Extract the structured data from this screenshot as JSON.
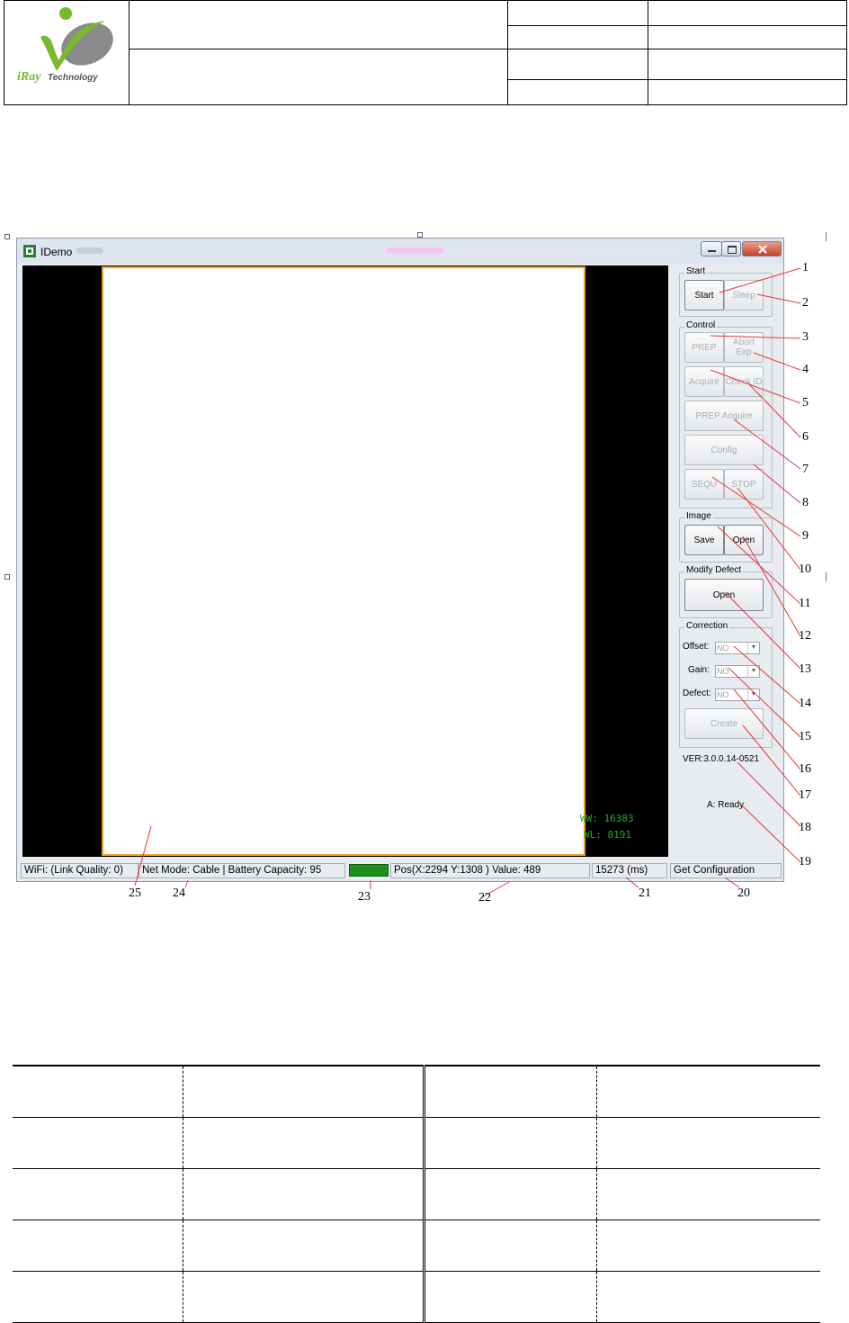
{
  "header": {
    "logo_text": "iRayTechnology",
    "logo_colors": {
      "green": "#7ab82e",
      "gray": "#8a8a8a"
    }
  },
  "window": {
    "title": "IDemo",
    "app_icon": "app-icon",
    "controls": [
      "minimize-icon",
      "maximize-icon",
      "close-icon"
    ],
    "viewer": {
      "ww": "WW: 16383",
      "wl": "WL:  8191"
    },
    "panel": {
      "start_group": {
        "title": "Start",
        "start": "Start",
        "sleep": "Sleep"
      },
      "control_group": {
        "title": "Control",
        "prep": "PREP",
        "abort": "Abort Exp",
        "acquire": "Acquire",
        "check_id": "Check ID",
        "prep_acquire": "PREP Acquire",
        "config": "Config",
        "sequ": "SEQU",
        "stop": "STOP"
      },
      "image_group": {
        "title": "Image",
        "save": "Save",
        "open": "Open"
      },
      "defect_group": {
        "title": "Modify Defect",
        "open": "Open"
      },
      "correction_group": {
        "title": "Correction",
        "offset_label": "Offset:",
        "offset_value": "NO",
        "gain_label": "Gain:",
        "gain_value": "NO",
        "defect_label": "Defect:",
        "defect_value": "NO",
        "create": "Create"
      },
      "version": "VER:3.0.0.14-0521",
      "state": "A: Ready"
    },
    "status_bar": {
      "link": "WiFi:  (Link Quality: 0)",
      "info": "Net Mode: Cable | Battery Capacity: 95",
      "indicator_color": "#1f8f1f",
      "pos": "Pos(X:2294 Y:1308 ) Value:   489",
      "time": "15273 (ms)",
      "message": "Get Configuration"
    }
  },
  "callouts": [
    "1",
    "2",
    "3",
    "4",
    "5",
    "6",
    "7",
    "8",
    "9",
    "10",
    "11",
    "12",
    "13",
    "14",
    "15",
    "16",
    "17",
    "18",
    "19",
    "20",
    "21",
    "22",
    "23",
    "24",
    "25"
  ]
}
